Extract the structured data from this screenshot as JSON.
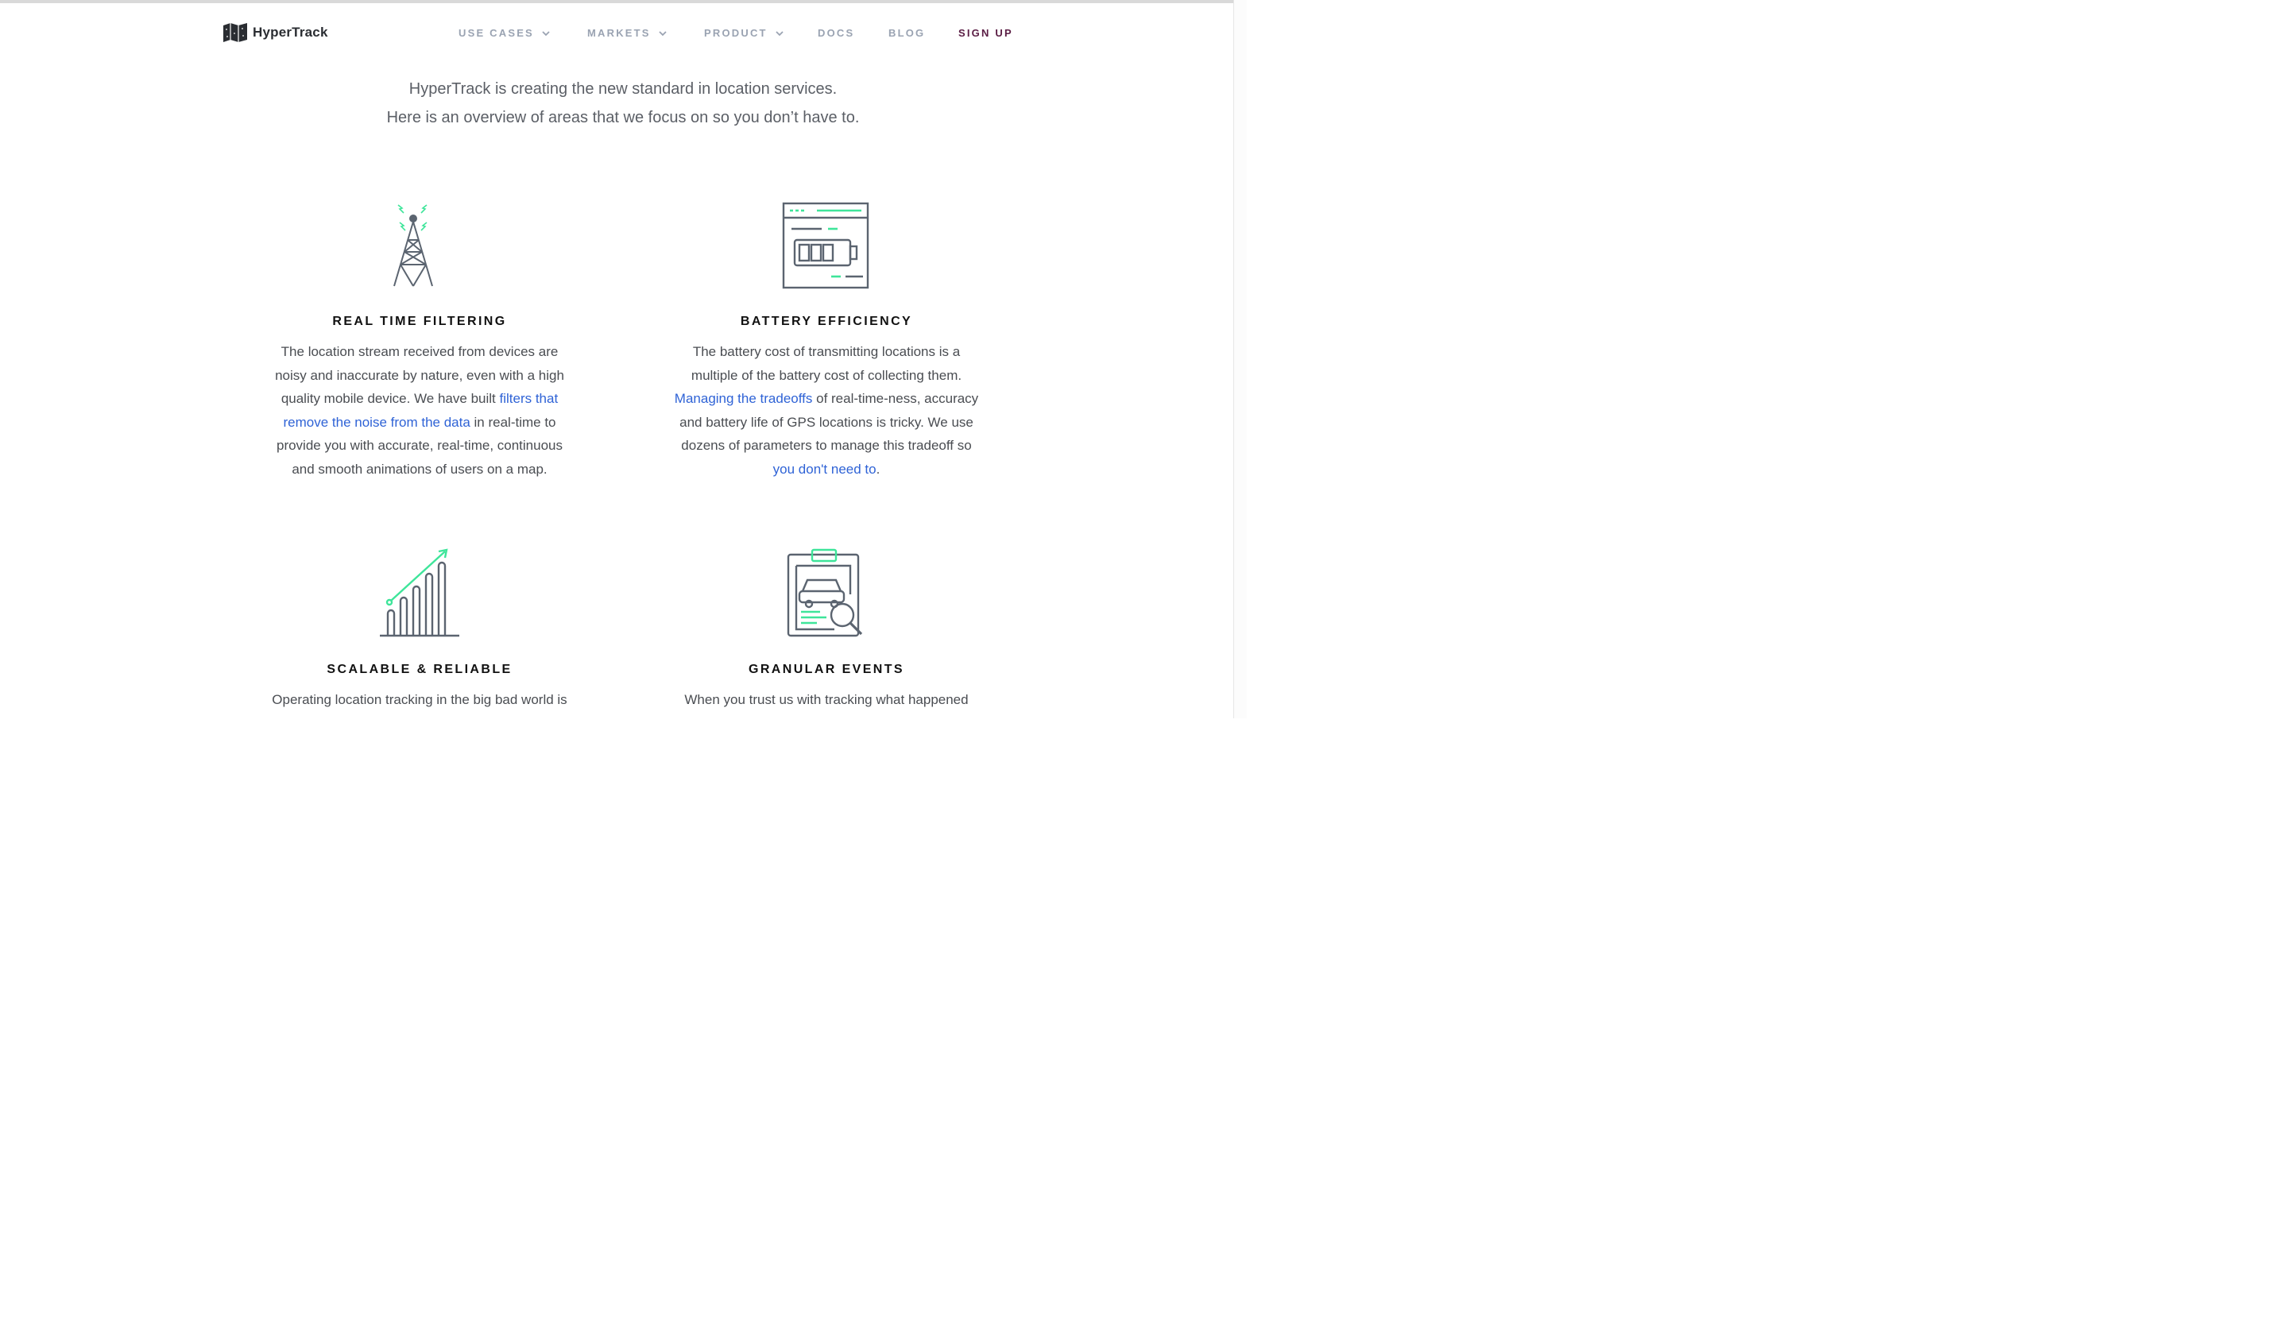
{
  "brand": {
    "name": "HyperTrack",
    "logo_icon": "folded-map-icon"
  },
  "nav": {
    "items": [
      {
        "label": "USE CASES",
        "has_dropdown": true
      },
      {
        "label": "MARKETS",
        "has_dropdown": true
      },
      {
        "label": "PRODUCT",
        "has_dropdown": true
      },
      {
        "label": "DOCS",
        "has_dropdown": false
      },
      {
        "label": "BLOG",
        "has_dropdown": false
      },
      {
        "label": "SIGN UP",
        "has_dropdown": false
      }
    ]
  },
  "intro": {
    "line1": "HyperTrack is creating the new standard in location services.",
    "line2": "Here is an overview of areas that we focus on so you don’t have to."
  },
  "features": [
    {
      "icon": "radio-tower-icon",
      "title": "REAL TIME FILTERING",
      "lines": [
        [
          {
            "t": "The location stream received from devices are"
          }
        ],
        [
          {
            "t": "noisy and inaccurate by nature, even with a high"
          }
        ],
        [
          {
            "t": "quality mobile device. We have built "
          },
          {
            "t": "filters that",
            "link": true
          }
        ],
        [
          {
            "t": "remove the noise from the data",
            "link": true
          },
          {
            "t": " in real-time to"
          }
        ],
        [
          {
            "t": "provide you with accurate, real-time, continuous"
          }
        ],
        [
          {
            "t": "and smooth animations of users on a map."
          }
        ]
      ]
    },
    {
      "icon": "battery-window-icon",
      "title": "BATTERY EFFICIENCY",
      "lines": [
        [
          {
            "t": "The battery cost of transmitting locations is a"
          }
        ],
        [
          {
            "t": "multiple of the battery cost of collecting them."
          }
        ],
        [
          {
            "t": "Managing the tradeoffs",
            "link": true
          },
          {
            "t": " of real-time-ness, accuracy"
          }
        ],
        [
          {
            "t": "and battery life of GPS locations is tricky. We use"
          }
        ],
        [
          {
            "t": "dozens of parameters to manage this tradeoff so"
          }
        ],
        [
          {
            "t": "you don't need to",
            "link": true
          },
          {
            "t": "."
          }
        ]
      ]
    },
    {
      "icon": "growth-chart-icon",
      "title": "SCALABLE & RELIABLE",
      "lines": [
        [
          {
            "t": "Operating location tracking in the big bad world is"
          }
        ]
      ]
    },
    {
      "icon": "clipboard-car-search-icon",
      "title": "GRANULAR EVENTS",
      "lines": [
        [
          {
            "t": "When you trust us with tracking what happened"
          }
        ]
      ]
    }
  ],
  "colors": {
    "accent_green": "#3ee59a",
    "icon_gray": "#5b6470",
    "link_blue": "#2f63d6",
    "signup": "#5a1d44",
    "nav_gray": "#9aa3b2"
  }
}
